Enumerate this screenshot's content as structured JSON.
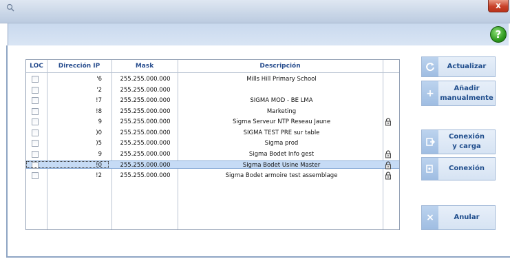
{
  "window": {
    "close_label": "x",
    "help_label": "?"
  },
  "table": {
    "columns": [
      "LOC",
      "Dirección IP",
      "Mask",
      "Descripción"
    ],
    "rows": [
      {
        "ip": "'6",
        "mask": "255.255.000.000",
        "desc": "Mills Hill Primary School",
        "locked": false,
        "selected": false
      },
      {
        "ip": "'2",
        "mask": "255.255.000.000",
        "desc": "",
        "locked": false,
        "selected": false
      },
      {
        "ip": "!7",
        "mask": "255.255.000.000",
        "desc": "SIGMA MOD - BE LMA",
        "locked": false,
        "selected": false
      },
      {
        "ip": "!8",
        "mask": "255.255.000.000",
        "desc": "Marketing",
        "locked": false,
        "selected": false
      },
      {
        "ip": "9",
        "mask": "255.255.000.000",
        "desc": "Sigma Serveur NTP Reseau Jaune",
        "locked": true,
        "selected": false
      },
      {
        "ip": ")0",
        "mask": "255.255.000.000",
        "desc": "SIGMA TEST PRE sur table",
        "locked": false,
        "selected": false
      },
      {
        "ip": ")5",
        "mask": "255.255.000.000",
        "desc": "Sigma prod",
        "locked": false,
        "selected": false
      },
      {
        "ip": "9",
        "mask": "255.255.000.000",
        "desc": "Sigma Bodet Info gest",
        "locked": true,
        "selected": false
      },
      {
        "ip": "!0",
        "mask": "255.255.000.000",
        "desc": "Sigma Bodet Usine Master",
        "locked": true,
        "selected": true
      },
      {
        "ip": "!2",
        "mask": "255.255.000.000",
        "desc": "Sigma Bodet armoire test assemblage",
        "locked": true,
        "selected": false
      }
    ]
  },
  "buttons": {
    "actualizar": "Actualizar",
    "anadir": "Añadir\nmanualmente",
    "conexion_carga": "Conexión\ny carga",
    "conexion": "Conexión",
    "anular": "Anular"
  }
}
